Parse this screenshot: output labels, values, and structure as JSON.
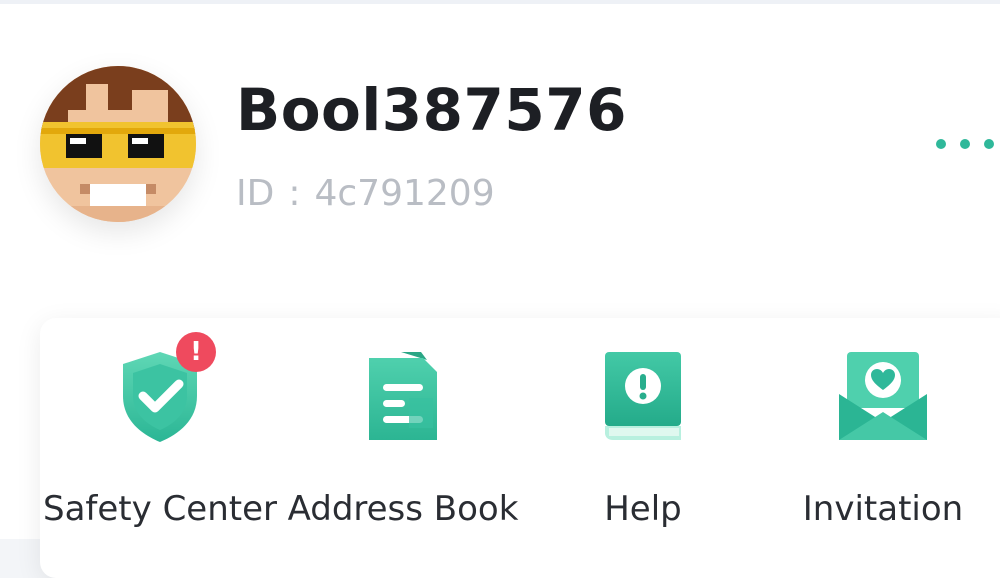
{
  "profile": {
    "username": "Bool387576",
    "id_label": "ID",
    "id_separator": ":",
    "id_value": "4c791209"
  },
  "menu": {
    "more_icon": "more-dots-icon"
  },
  "features": [
    {
      "label": "Safety Center",
      "icon": "shield-check-icon",
      "badge": "!"
    },
    {
      "label": "Address Book",
      "icon": "address-book-icon"
    },
    {
      "label": "Help",
      "icon": "help-book-icon"
    },
    {
      "label": "Invitation",
      "icon": "invitation-envelope-icon"
    }
  ],
  "colors": {
    "accent": "#2fb89a",
    "badge": "#ef4a5e"
  }
}
